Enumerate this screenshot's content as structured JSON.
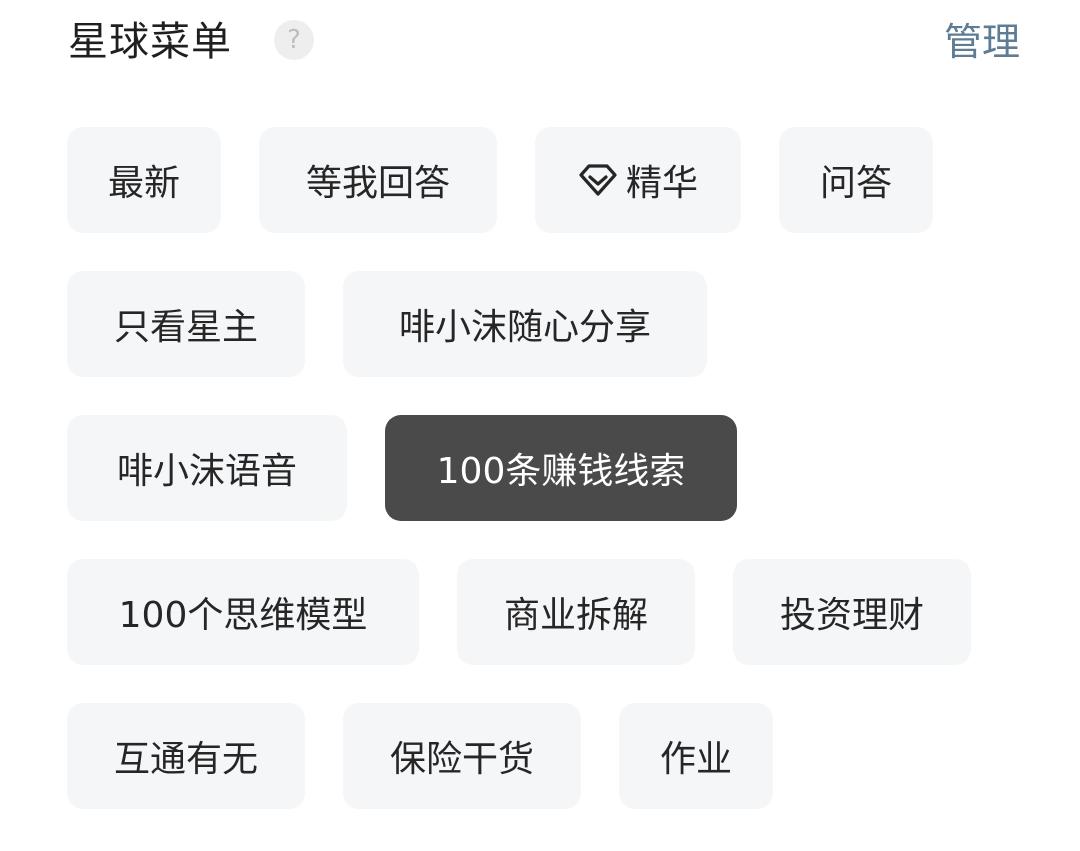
{
  "header": {
    "title": "星球菜单",
    "help_glyph": "?",
    "manage_label": "管理"
  },
  "menu": {
    "items": [
      {
        "label": "最新",
        "active": false
      },
      {
        "label": "等我回答",
        "active": false
      },
      {
        "label": "精华",
        "icon": "diamond-icon",
        "active": false
      },
      {
        "label": "问答",
        "active": false
      },
      {
        "label": "只看星主",
        "active": false
      },
      {
        "label": "啡小沫随心分享",
        "active": false
      },
      {
        "label": "啡小沫语音",
        "active": false
      },
      {
        "label": "100条赚钱线索",
        "active": true
      },
      {
        "label": "100个思维模型",
        "active": false
      },
      {
        "label": "商业拆解",
        "active": false
      },
      {
        "label": "投资理财",
        "active": false
      },
      {
        "label": "互通有无",
        "active": false
      },
      {
        "label": "保险干货",
        "active": false
      },
      {
        "label": "作业",
        "active": false
      }
    ]
  },
  "colors": {
    "chip_bg": "#f5f6f8",
    "chip_active_bg": "#4a4a4a",
    "manage_link": "#5e7c94"
  }
}
